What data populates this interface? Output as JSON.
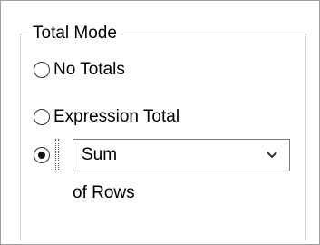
{
  "total_mode": {
    "title": "Total Mode",
    "options": [
      {
        "label": "No Totals",
        "checked": false
      },
      {
        "label": "Expression Total",
        "checked": false
      },
      {
        "label": "",
        "checked": true
      }
    ],
    "aggregate": {
      "selected": "Sum",
      "suffix": "of Rows"
    }
  }
}
